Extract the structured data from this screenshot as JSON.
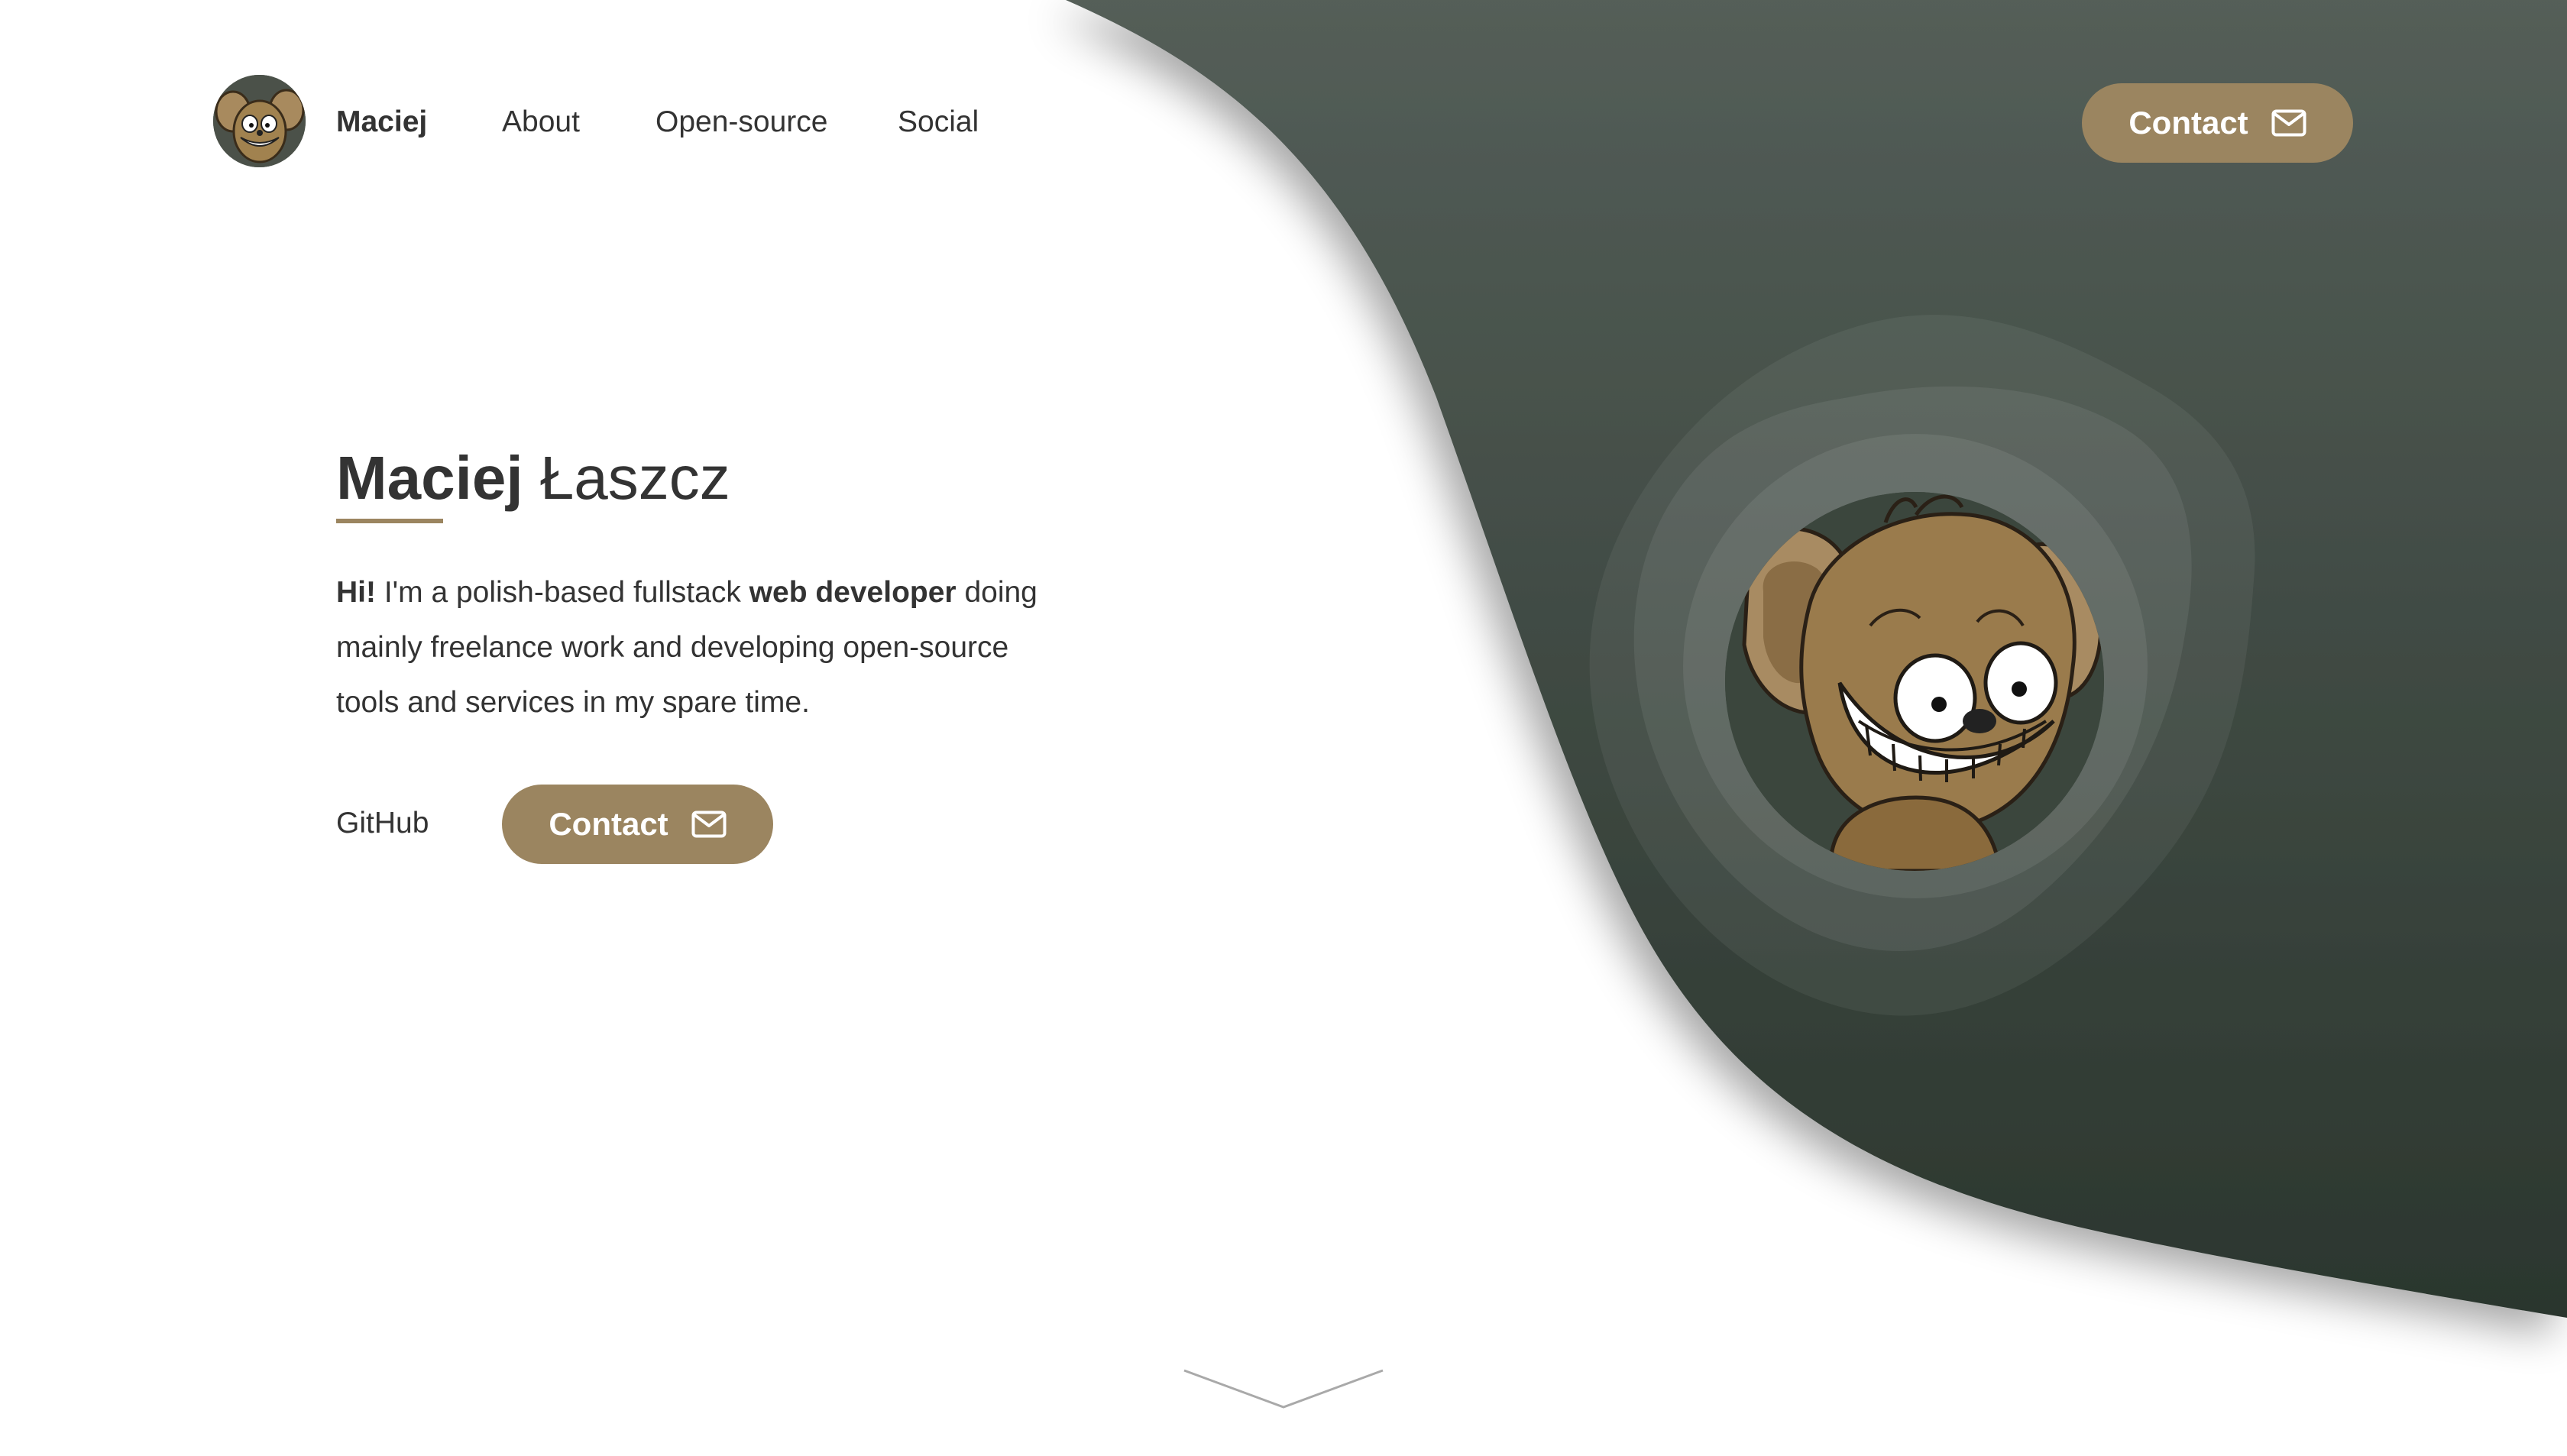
{
  "nav": {
    "brand": "Maciej",
    "links": [
      "About",
      "Open-source",
      "Social"
    ],
    "contact_label": "Contact",
    "avatar_icon": "mouse-avatar-icon"
  },
  "hero": {
    "title_first": "Maciej",
    "title_last": "Łaszcz",
    "intro_hi": "Hi!",
    "intro_part1": " I'm a polish-based fullstack ",
    "intro_bold": "web developer",
    "intro_part2": " doing mainly freelance work and developing open-source tools and services in my spare time.",
    "github_label": "GitHub",
    "contact_label": "Contact"
  },
  "icons": {
    "mail": "mail-icon",
    "scroll": "chevron-down-icon",
    "portrait": "mouse-portrait-icon"
  },
  "colors": {
    "accent": "#9b8560",
    "dark_bg_top": "#545e58",
    "dark_bg_bottom": "#2c372f",
    "text": "#333333"
  }
}
